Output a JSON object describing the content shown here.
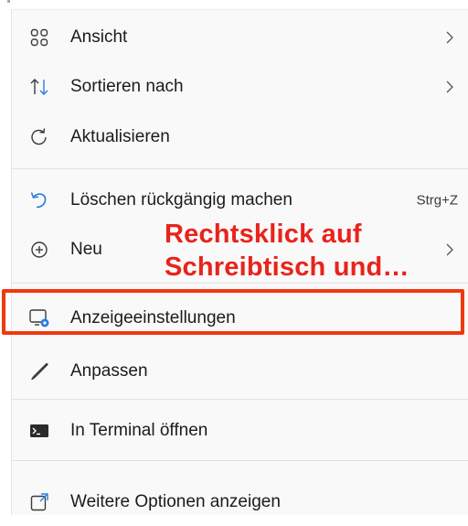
{
  "menu": {
    "items": [
      {
        "label": "Ansicht",
        "icon": "view-grid-icon",
        "submenu": true
      },
      {
        "label": "Sortieren nach",
        "icon": "sort-arrows-icon",
        "submenu": true
      },
      {
        "label": "Aktualisieren",
        "icon": "refresh-icon",
        "submenu": false
      },
      {
        "label": "Löschen rückgängig machen",
        "icon": "undo-icon",
        "shortcut": "Strg+Z"
      },
      {
        "label": "Neu",
        "icon": "add-circle-icon",
        "submenu": true
      },
      {
        "label": "Anzeigeeinstellungen",
        "icon": "display-settings-icon",
        "submenu": false,
        "highlighted": true
      },
      {
        "label": "Anpassen",
        "icon": "brush-icon",
        "submenu": false
      },
      {
        "label": "In Terminal öffnen",
        "icon": "terminal-icon",
        "submenu": false
      },
      {
        "label": "Weitere Optionen anzeigen",
        "icon": "open-external-icon",
        "submenu": false
      }
    ]
  },
  "annotation": {
    "text": "Rechtsklick auf\nSchreibtisch und…",
    "color": "#e9231b"
  },
  "highlight_color": "#f0380f",
  "accent_color": "#2a7de1"
}
